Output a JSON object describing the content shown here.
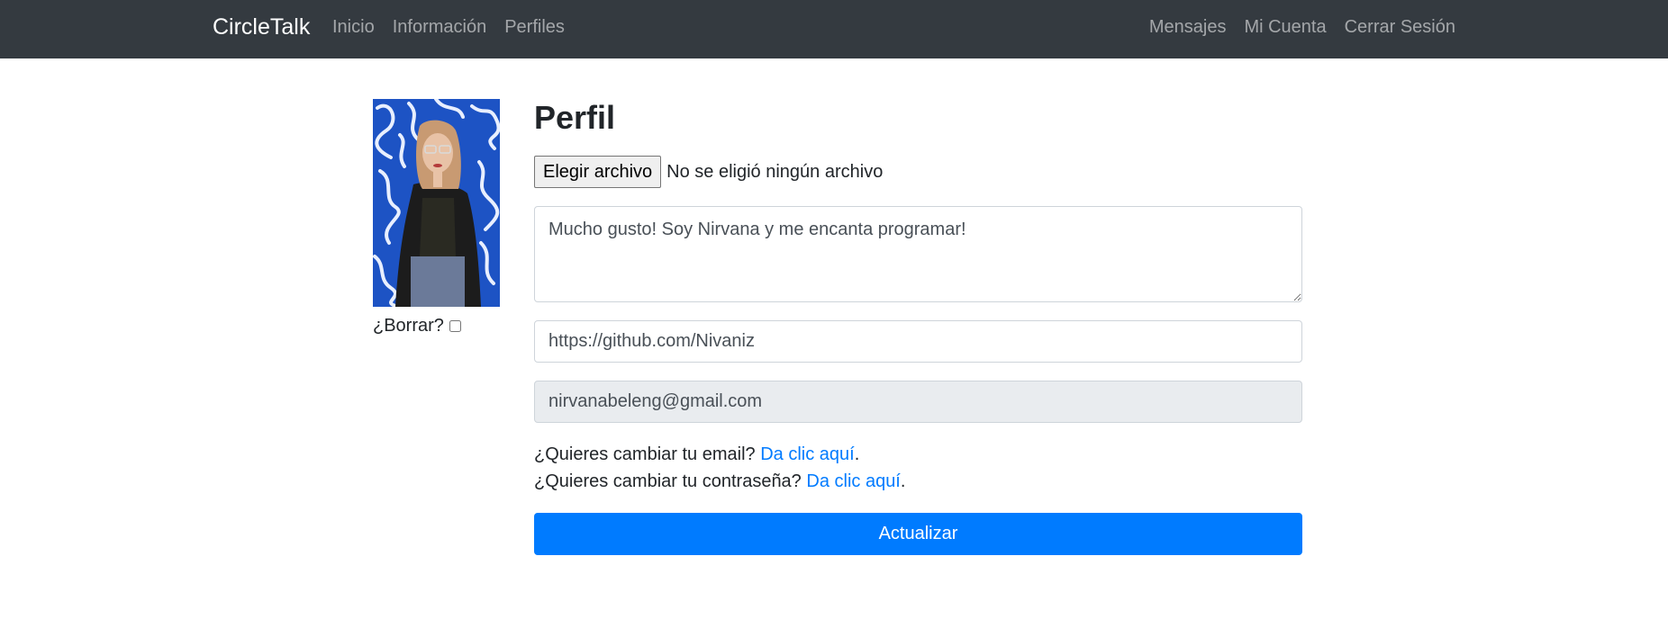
{
  "navbar": {
    "brand": "CircleTalk",
    "left_links": [
      "Inicio",
      "Información",
      "Perfiles"
    ],
    "right_links": [
      "Mensajes",
      "Mi Cuenta",
      "Cerrar Sesión"
    ],
    "background": "#343a40"
  },
  "profile": {
    "title": "Perfil",
    "file_button": "Elegir archivo",
    "file_status": "No se eligió ningún archivo",
    "delete_label": "¿Borrar?",
    "bio": "Mucho gusto! Soy Nirvana y me encanta programar!",
    "url": "https://github.com/Nivaniz",
    "email": "nirvanabeleng@gmail.com",
    "change_email_text": "¿Quieres cambiar tu email?",
    "change_password_text": "¿Quieres cambiar tu contraseña?",
    "link_text": "Da clic aquí",
    "submit_label": "Actualizar",
    "accent": "#007bff"
  }
}
